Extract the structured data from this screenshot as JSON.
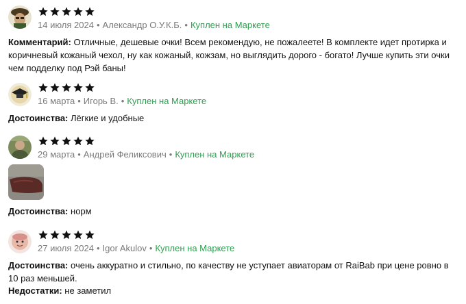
{
  "reviews": [
    {
      "rating": 5,
      "date": "14 июля 2024",
      "author": "Александр О.У.К.Б.",
      "badge": "Куплен на Маркете",
      "lines": [
        {
          "label": "Комментарий:",
          "text": "Отличные, дешевые очки! Всем рекомендую, не пожалеете! В комплекте идет протирка и коричневый кожаный чехол, ну как кожаный, кожзам, но выглядить дорого - богато! Лучше купить эти очки чем подделку под Рэй баны!"
        }
      ]
    },
    {
      "rating": 5,
      "date": "16 марта",
      "author": "Игорь В.",
      "badge": "Куплен на Маркете",
      "lines": [
        {
          "label": "Достоинства:",
          "text": "Лёгкие и удобные"
        }
      ]
    },
    {
      "rating": 5,
      "date": "29 марта",
      "author": "Андрей Феликсович",
      "badge": "Куплен на Маркете",
      "lines": [
        {
          "label": "Достоинства:",
          "text": "норм"
        }
      ]
    },
    {
      "rating": 5,
      "date": "27 июля 2024",
      "author": "Igor Akulov",
      "badge": "Куплен на Маркете",
      "lines": [
        {
          "label": "Достоинства:",
          "text": "очень аккуратно и стильно, по качеству не уступает авиаторам от RaiBab при цене ровно в 10 раз меньшей."
        },
        {
          "label": "Недостатки:",
          "text": "не заметил"
        }
      ]
    }
  ],
  "colors": {
    "star": "#111111",
    "bought": "#2e9e4f",
    "meta": "#7a7a7a"
  },
  "icons": {
    "star": "star-icon",
    "separator": "•"
  }
}
